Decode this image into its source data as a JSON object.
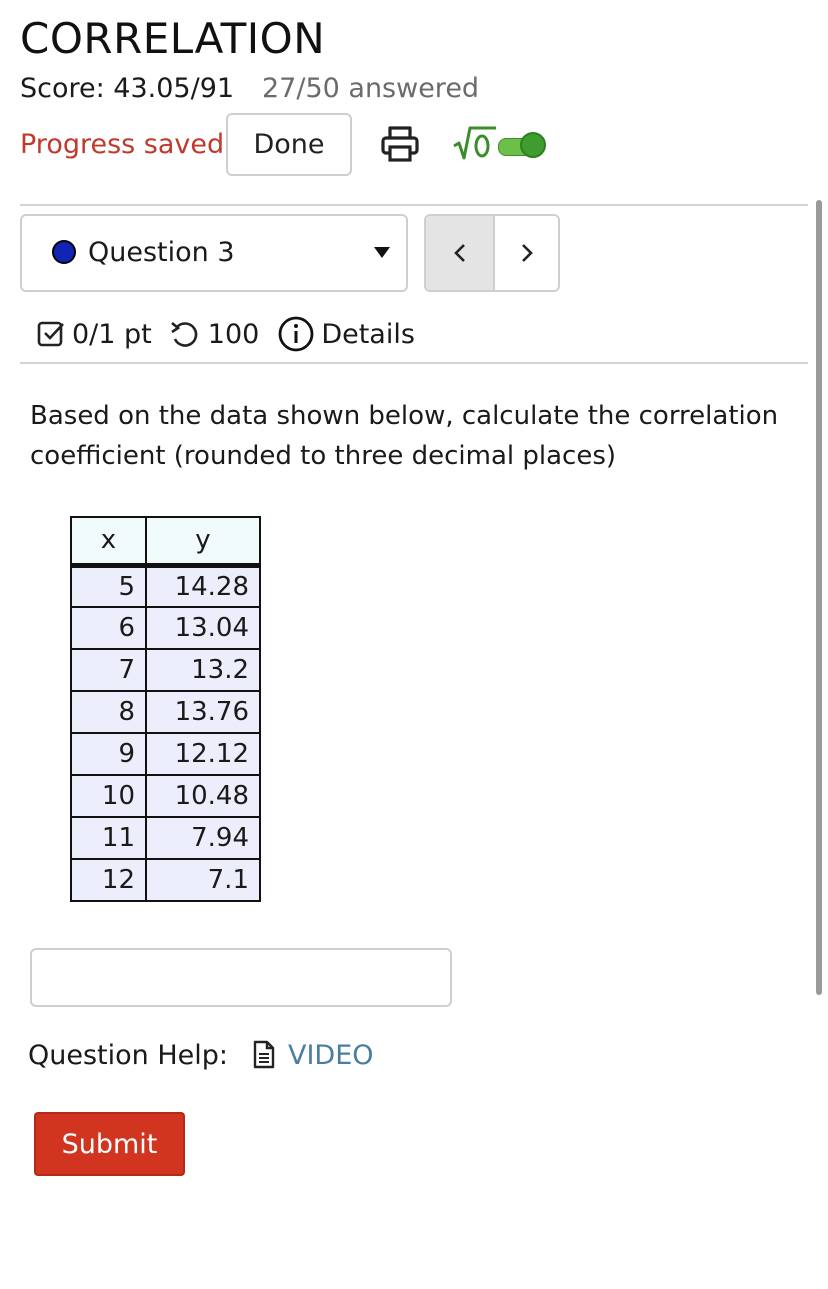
{
  "header": {
    "title": "CORRELATION",
    "score": "Score: 43.05/91",
    "answered": "27/50 answered",
    "progress_status": "Progress saved",
    "done_label": "Done",
    "print_icon": "printer-icon",
    "math_toggle_icon": "sqrt-zero-icon",
    "math_toggle_on": true
  },
  "question_nav": {
    "selected_question": "Question 3",
    "prev_label": "<",
    "next_label": ">",
    "status_dot_color": "#1024b8"
  },
  "question_meta": {
    "points": "0/1 pt",
    "attempts": "100",
    "details_label": "Details"
  },
  "question": {
    "text": "Based on the data shown below, calculate the correlation coefficient (rounded to three decimal places)",
    "table": {
      "headers": [
        "x",
        "y"
      ],
      "rows": [
        [
          "5",
          "14.28"
        ],
        [
          "6",
          "13.04"
        ],
        [
          "7",
          "13.2"
        ],
        [
          "8",
          "13.76"
        ],
        [
          "9",
          "12.12"
        ],
        [
          "10",
          "10.48"
        ],
        [
          "11",
          "7.94"
        ],
        [
          "12",
          "7.1"
        ]
      ]
    },
    "answer_value": ""
  },
  "help": {
    "label": "Question Help:",
    "video_label": "VIDEO"
  },
  "submit_label": "Submit",
  "colors": {
    "accent_red": "#d2351f",
    "progress_red": "#c0392b",
    "link_blue": "#4a7ea0",
    "toggle_green": "#3f9c2f"
  }
}
